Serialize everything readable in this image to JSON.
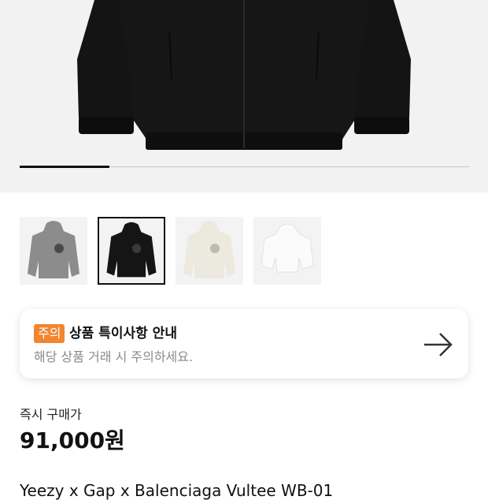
{
  "gallery": {
    "progress_fraction": 0.2,
    "thumbnails": [
      {
        "name": "gray",
        "color": "#8c8c8c",
        "selected": false
      },
      {
        "name": "black",
        "color": "#151515",
        "selected": true
      },
      {
        "name": "cream",
        "color": "#ece9df",
        "selected": false
      },
      {
        "name": "white",
        "color": "#f4f4f4",
        "selected": false
      }
    ]
  },
  "notice": {
    "badge": "주의",
    "title": "상품 특이사항 안내",
    "subtitle": "해당 상품 거래 시 주의하세요.",
    "badge_color": "#f2852f",
    "icon": "arrow-right-icon"
  },
  "price": {
    "label": "즉시 구매가",
    "value": "91,000원"
  },
  "product": {
    "name": "Yeezy x Gap x Balenciaga Vultee WB-01"
  }
}
